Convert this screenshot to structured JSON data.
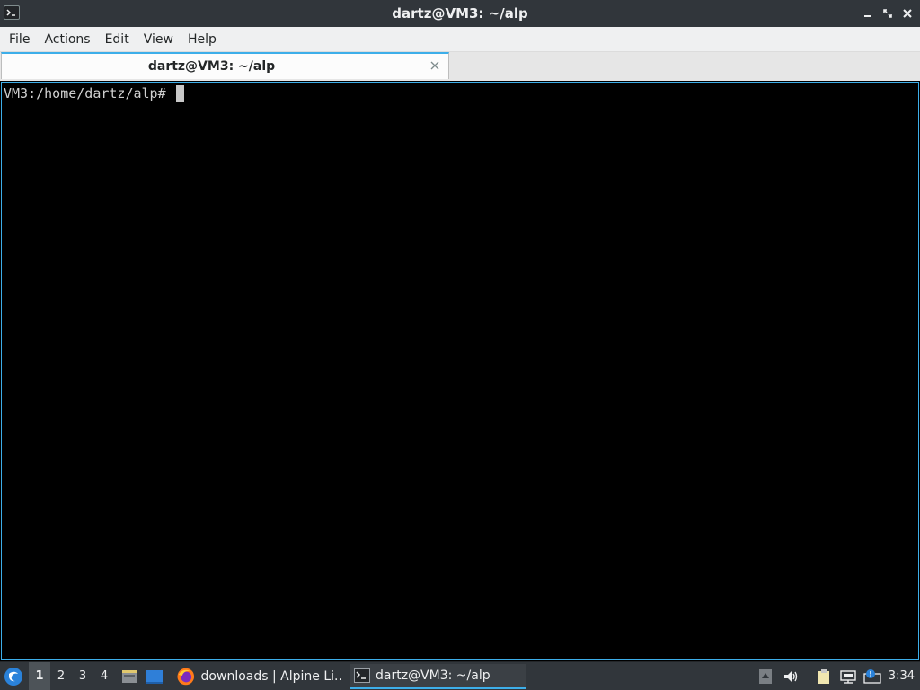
{
  "window": {
    "title": "dartz@VM3: ~/alp"
  },
  "menubar": {
    "items": [
      "File",
      "Actions",
      "Edit",
      "View",
      "Help"
    ]
  },
  "tabs": [
    {
      "label": "dartz@VM3: ~/alp",
      "active": true
    }
  ],
  "terminal": {
    "prompt": "VM3:/home/dartz/alp# "
  },
  "taskbar": {
    "desktops": [
      "1",
      "2",
      "3",
      "4"
    ],
    "active_desktop": "1",
    "tasks": [
      {
        "label": "downloads | Alpine Li...",
        "icon": "firefox-icon"
      },
      {
        "label": "dartz@VM3: ~/alp",
        "icon": "terminal-icon",
        "active": true
      }
    ],
    "clock": "3:34"
  },
  "colors": {
    "accent": "#3daee9",
    "titlebar": "#31363b",
    "menubar": "#eff0f1",
    "terminal_bg": "#000000",
    "terminal_fg": "#d0d0d0"
  }
}
